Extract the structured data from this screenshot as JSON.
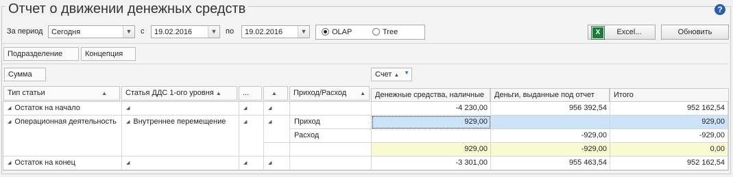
{
  "title": "Отчет о движении денежных средств",
  "help_icon": "?",
  "filters": {
    "period_label": "За период",
    "period_value": "Сегодня",
    "from_label": "с",
    "from_value": "19.02.2016",
    "to_label": "по",
    "to_value": "19.02.2016",
    "mode_olap": "OLAP",
    "mode_tree": "Tree"
  },
  "toolbar": {
    "excel_label": "Excel...",
    "excel_icon": "X",
    "refresh_label": "Обновить"
  },
  "filter_fields": [
    "Подразделение",
    "Концепция"
  ],
  "data_field": "Сумма",
  "column_field": "Счет",
  "sort_asc": "▲",
  "row_headers": [
    "Тип статьи",
    "Статья ДДС 1-ого уровня",
    "...",
    "",
    "Приход/Расход"
  ],
  "col_headers": [
    "Денежные средства, наличные",
    "Деньги, выданные под отчет",
    "Итого"
  ],
  "tree_mark": "◢",
  "rows": {
    "r1": {
      "type": "Остаток на начало",
      "v1": "-4 230,00",
      "v2": "956 392,54",
      "v3": "952 162,54"
    },
    "r2": {
      "type": "Операционная деятельность",
      "article": "Внутреннее перемещение",
      "io": "Приход",
      "v1": "929,00",
      "v2": "",
      "v3": "929,00"
    },
    "r3": {
      "io": "Расход",
      "v1": "",
      "v2": "-929,00",
      "v3": "-929,00"
    },
    "r4": {
      "v1": "929,00",
      "v2": "-929,00",
      "v3": "0,00"
    },
    "r5": {
      "type": "Остаток на конец",
      "v1": "-3 301,00",
      "v2": "955 463,54",
      "v3": "952 162,54"
    }
  }
}
